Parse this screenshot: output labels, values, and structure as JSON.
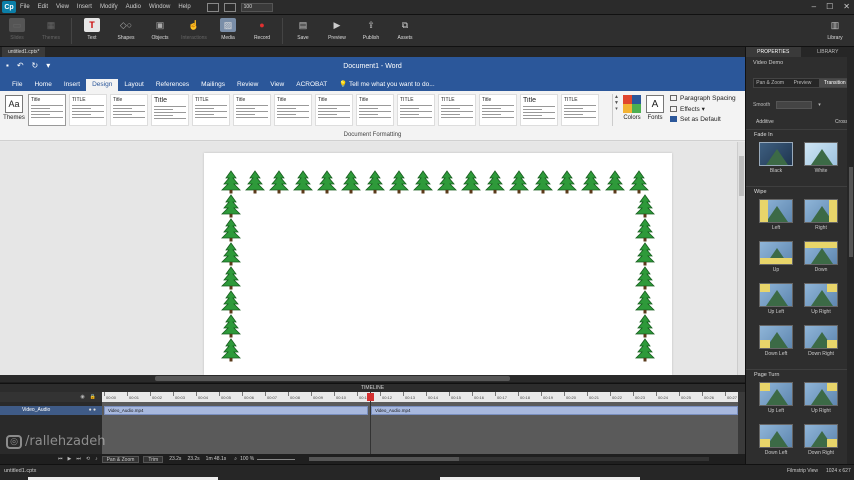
{
  "app": {
    "logo": "Cp",
    "menu": [
      "File",
      "Edit",
      "View",
      "Insert",
      "Modify",
      "Audio",
      "Window",
      "Help"
    ],
    "zoom": "100"
  },
  "toolbar": {
    "slides": "Slides",
    "themes": "Themes",
    "text": "Text",
    "shapes": "Shapes",
    "objects": "Objects",
    "interactions": "Interactions",
    "media": "Media",
    "record": "Record",
    "save": "Save",
    "preview": "Preview",
    "publish": "Publish",
    "assets": "Assets",
    "library": "Library"
  },
  "project_tab": "untitled1.cptx*",
  "word": {
    "title": "Document1 - Word",
    "tabs": [
      "File",
      "Home",
      "Insert",
      "Design",
      "Layout",
      "References",
      "Mailings",
      "Review",
      "View",
      "ACROBAT"
    ],
    "active_tab": "Design",
    "tell_me": "Tell me what you want to do...",
    "themes_label": "Themes",
    "themes_glyph": "Aa",
    "style_gallery": [
      {
        "title": "Title",
        "big": false
      },
      {
        "title": "TITLE",
        "big": false
      },
      {
        "title": "Title",
        "big": false
      },
      {
        "title": "Title",
        "big": true
      },
      {
        "title": "TITLE",
        "big": false
      },
      {
        "title": "Title",
        "big": false
      },
      {
        "title": "Title",
        "big": false
      },
      {
        "title": "Title",
        "big": false
      },
      {
        "title": "Title",
        "big": false
      },
      {
        "title": "TITLE",
        "big": false
      },
      {
        "title": "TITLE",
        "big": false
      },
      {
        "title": "Title",
        "big": false
      },
      {
        "title": "Title",
        "big": true
      },
      {
        "title": "TITLE",
        "big": false
      }
    ],
    "colors_label": "Colors",
    "fonts_label": "Fonts",
    "fonts_glyph": "A",
    "paragraph_spacing": "Paragraph Spacing",
    "effects": "Effects",
    "set_as_default": "Set as Default",
    "group_label": "Document Formatting",
    "palette_colors": [
      "#e0462e",
      "#2b579a",
      "#f2b233",
      "#4caf50"
    ]
  },
  "timeline": {
    "title": "TIMELINE",
    "layer_name": "Video_Audio",
    "clips": [
      {
        "label": "Video_Audio.mp4"
      },
      {
        "label": "Video_Audio.mp4"
      }
    ],
    "ticks": [
      "00:00",
      "00:01",
      "00:02",
      "00:03",
      "00:04",
      "00:05",
      "00:06",
      "00:07",
      "00:08",
      "00:09",
      "00:10",
      "00:11",
      "00:12",
      "00:13",
      "00:14",
      "00:15",
      "00:16",
      "00:17",
      "00:18",
      "00:19",
      "00:20",
      "00:21",
      "00:22",
      "00:23",
      "00:24",
      "00:25",
      "00:26",
      "00:27"
    ],
    "status_tabs": [
      "Pan & Zoom",
      "Trim"
    ],
    "time_readouts": [
      "23.2s",
      "23.2s",
      "1m 48.1s"
    ],
    "zoom": "100 %"
  },
  "status": {
    "file": "untitled1.cptx",
    "view": "Filmstrip View",
    "dims": "1024 x 627"
  },
  "watermark": "/rallehzadeh",
  "props": {
    "tabs": [
      "PROPERTIES",
      "LIBRARY"
    ],
    "section": "Video Demo",
    "subtabs": [
      "Pan & Zoom",
      "Preview",
      "Transition"
    ],
    "speed_label": "Smooth",
    "blend_modes": [
      "Additive",
      "Cross"
    ],
    "categories": [
      {
        "name": "Fade In",
        "effects": [
          "Black",
          "White"
        ]
      },
      {
        "name": "Wipe",
        "effects": [
          "Left",
          "Right",
          "Up",
          "Down",
          "Up Left",
          "Up Right",
          "Down Left",
          "Down Right"
        ]
      },
      {
        "name": "Page Turn",
        "effects": [
          "Up Left",
          "Up Right",
          "Down Left",
          "Down Right"
        ]
      }
    ]
  }
}
